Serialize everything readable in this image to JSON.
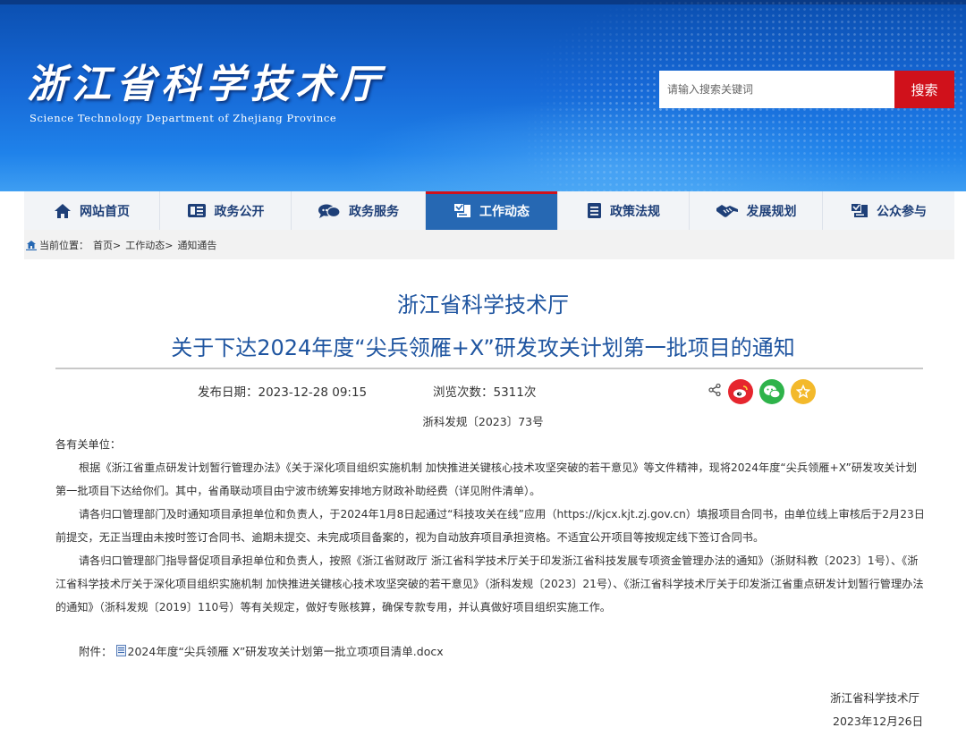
{
  "header": {
    "site_name_cn": "浙江省科学技术厅",
    "site_name_en": "Science Technology Department of Zhejiang Province",
    "search": {
      "placeholder": "请输入搜索关键词",
      "button_label": "搜索"
    }
  },
  "nav": {
    "items": [
      {
        "label": "网站首页",
        "icon": "home-icon"
      },
      {
        "label": "政务公开",
        "icon": "news-icon"
      },
      {
        "label": "政务服务",
        "icon": "chat-icon"
      },
      {
        "label": "工作动态",
        "icon": "work-icon",
        "active": true
      },
      {
        "label": "政策法规",
        "icon": "document-icon"
      },
      {
        "label": "发展规划",
        "icon": "handshake-icon"
      },
      {
        "label": "公众参与",
        "icon": "participation-icon"
      }
    ]
  },
  "breadcrumb": {
    "prefix": "当前位置：",
    "items": [
      "首页>",
      "工作动态>",
      "通知通告"
    ]
  },
  "article": {
    "org_title": "浙江省科学技术厅",
    "title": "关于下达2024年度“尖兵领雁+X”研发攻关计划第一批项目的通知",
    "publish_date": "发布日期：2023-12-28 09:15",
    "views": "浏览次数：5311次",
    "doc_number": "浙科发规〔2023〕73号",
    "greeting": "各有关单位：",
    "paragraphs": [
      "根据《浙江省重点研发计划暂行管理办法》《关于深化项目组织实施机制 加快推进关键核心技术攻坚突破的若干意见》等文件精神，现将2024年度“尖兵领雁+X”研发攻关计划第一批项目下达给你们。其中，省甬联动项目由宁波市统筹安排地方财政补助经费（详见附件清单）。",
      "请各归口管理部门及时通知项目承担单位和负责人，于2024年1月8日起通过“科技攻关在线”应用（https://kjcx.kjt.zj.gov.cn）填报项目合同书，由单位线上审核后于2月23日前提交，无正当理由未按时签订合同书、逾期未提交、未完成项目备案的，视为自动放弃项目承担资格。不适宜公开项目等按规定线下签订合同书。",
      "请各归口管理部门指导督促项目承担单位和负责人，按照《浙江省财政厅 浙江省科学技术厅关于印发浙江省科技发展专项资金管理办法的通知》（浙财科教〔2023〕1号）、《浙江省科学技术厅关于深化项目组织实施机制 加快推进关键核心技术攻坚突破的若干意见》（浙科发规〔2023〕21号）、《浙江省科学技术厅关于印发浙江省重点研发计划暂行管理办法的通知》（浙科发规〔2019〕110号）等有关规定，做好专账核算，确保专款专用，并认真做好项目组织实施工作。"
    ],
    "attachment_label": "附件：",
    "attachment_file": "2024年度“尖兵领雁 X”研发攻关计划第一批立项项目清单.docx",
    "signature_org": "浙江省科学技术厅",
    "signature_date": "2023年12月26日"
  },
  "colors": {
    "nav_text": "#1e3f78",
    "nav_active_bg": "#2668b3",
    "title": "#1f55a0",
    "search_button": "#d0111b",
    "weibo": "#e6262e",
    "wechat": "#2eb34a",
    "favorite": "#f3b92b"
  }
}
